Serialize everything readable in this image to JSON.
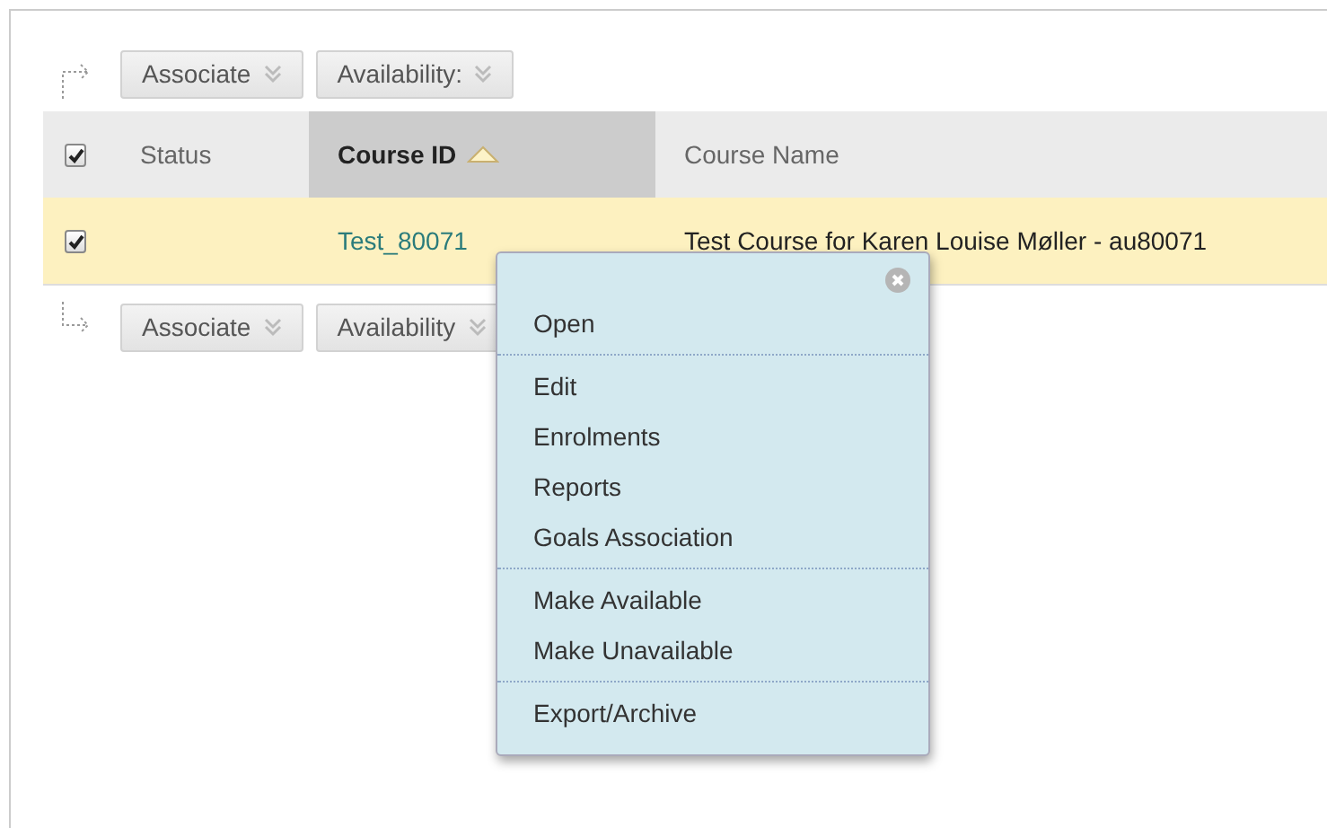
{
  "top_actions": [
    {
      "label": "Associate"
    },
    {
      "label": "Availability:"
    }
  ],
  "table": {
    "select_all_checked": true,
    "columns": [
      {
        "label": "Status",
        "sorted": false
      },
      {
        "label": "Course ID",
        "sorted": true
      },
      {
        "label": "Course Name",
        "sorted": false
      }
    ],
    "rows": [
      {
        "checked": true,
        "selected": true,
        "status": "",
        "course_id": "Test_80071",
        "course_name": "Test Course for Karen Louise Møller - au80071"
      }
    ]
  },
  "bottom_actions": [
    {
      "label": "Associate"
    },
    {
      "label": "Availability"
    }
  ],
  "context_menu": {
    "groups": [
      {
        "items": [
          "Open"
        ]
      },
      {
        "items": [
          "Edit",
          "Enrolments",
          "Reports",
          "Goals Association"
        ]
      },
      {
        "items": [
          "Make Available",
          "Make Unavailable"
        ]
      },
      {
        "items": [
          "Export/Archive"
        ]
      }
    ]
  }
}
